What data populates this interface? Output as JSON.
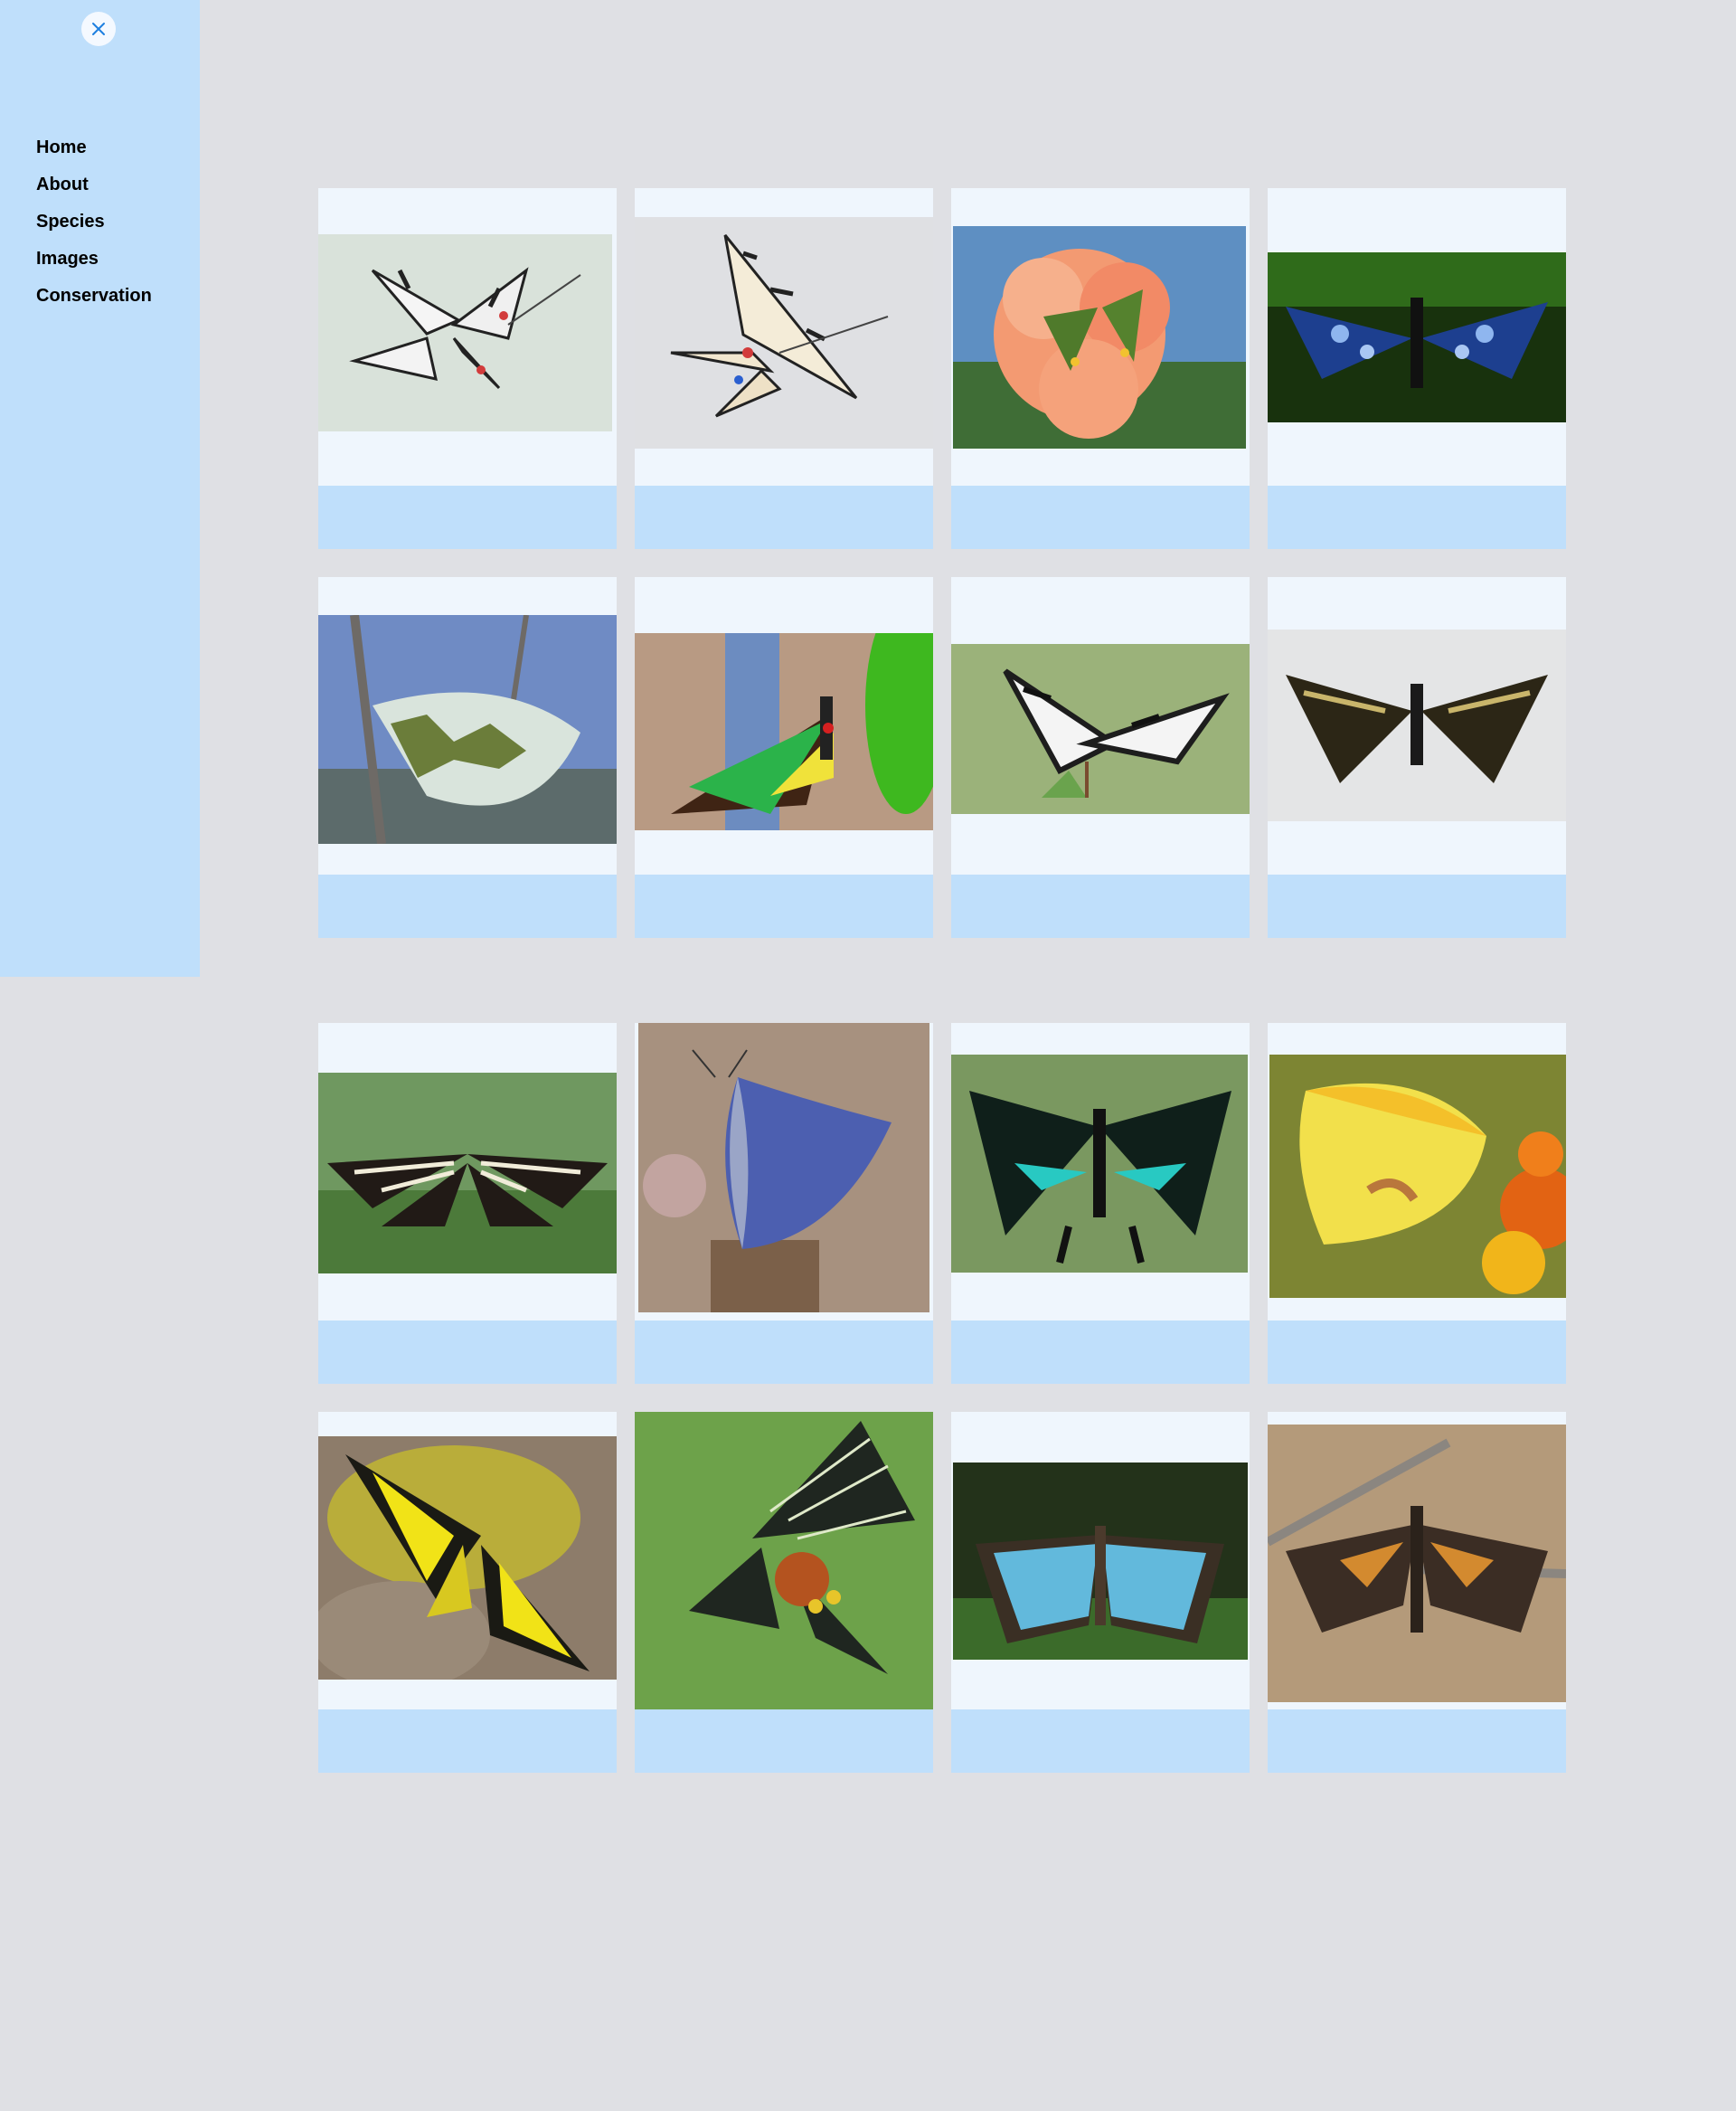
{
  "sidebar": {
    "close_icon": "close-icon",
    "nav": [
      "Home",
      "About",
      "Species",
      "Images",
      "Conservation"
    ]
  },
  "gallery": {
    "items": [
      {
        "subject": "Scarce swallowtail (top)"
      },
      {
        "subject": "Scarce swallowtail (side)"
      },
      {
        "subject": "Green butterfly on orange hibiscus"
      },
      {
        "subject": "Blue cracker butterfly"
      },
      {
        "subject": "Green-veined white on twig"
      },
      {
        "subject": "Cairns birdwing"
      },
      {
        "subject": "Zebra swallowtail on leaves"
      },
      {
        "subject": "Schaus swallowtail"
      },
      {
        "subject": "Zebra longwing"
      },
      {
        "subject": "Blue butterfly on flower"
      },
      {
        "subject": "Green-banded swallowtail"
      },
      {
        "subject": "Yellow sulphur on lantana"
      },
      {
        "subject": "Yellow birdwing on rock"
      },
      {
        "subject": "Bhutan glory"
      },
      {
        "subject": "Blue morpho"
      },
      {
        "subject": "Orange spotted moth on branch"
      }
    ]
  },
  "colors": {
    "background": "#dfe0e4",
    "sidebar": "#bfdffb",
    "card": "#eff6fd",
    "card_footer": "#bfdffb",
    "close_icon": "#1d7fe0"
  }
}
